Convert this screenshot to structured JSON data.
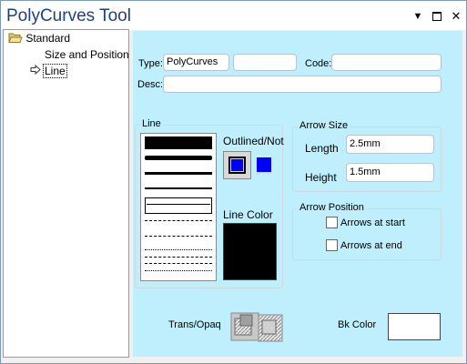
{
  "window": {
    "title": "PolyCurves Tool",
    "controls": [
      "dropdown-icon",
      "maximize-icon",
      "close-icon"
    ]
  },
  "tree": {
    "root": {
      "label": "Standard",
      "icon": "folder-open-icon"
    },
    "items": [
      {
        "label": "Size and Position",
        "selected": false
      },
      {
        "label": "Line",
        "selected": true,
        "icon": "arrow-right-icon"
      }
    ]
  },
  "fields": {
    "type_label": "Type:",
    "type_value": "PolyCurves",
    "type_extra_value": "",
    "code_label": "Code:",
    "code_value": "",
    "desc_label": "Desc:",
    "desc_value": ""
  },
  "line_group": {
    "legend": "Line",
    "outlined_label": "Outlined/Not",
    "line_color_label": "Line Color",
    "line_color": "#000000",
    "outline_fill_color": "#0000ff",
    "line_styles": [
      "thick-solid",
      "rough-solid",
      "medium-solid",
      "thin-solid",
      "hairline-selected",
      "long-dash",
      "dash",
      "dot",
      "dash-dot",
      "dash-dot-dot",
      "fine-dash"
    ],
    "selected_style": "hairline-selected"
  },
  "arrow_size": {
    "legend": "Arrow Size",
    "length_label": "Length",
    "length_value": "2.5mm",
    "height_label": "Height",
    "height_value": "1.5mm"
  },
  "arrow_position": {
    "legend": "Arrow Position",
    "start_label": "Arrows at start",
    "start_checked": false,
    "end_label": "Arrows at end",
    "end_checked": false
  },
  "bottom": {
    "trans_label": "Trans/Opaq",
    "bk_color_label": "Bk Color",
    "bk_color": "#ffffff"
  },
  "colors": {
    "title_text": "#1e3f8a",
    "panel_bg": "#bfeffd",
    "window_border": "#7a98c0"
  }
}
